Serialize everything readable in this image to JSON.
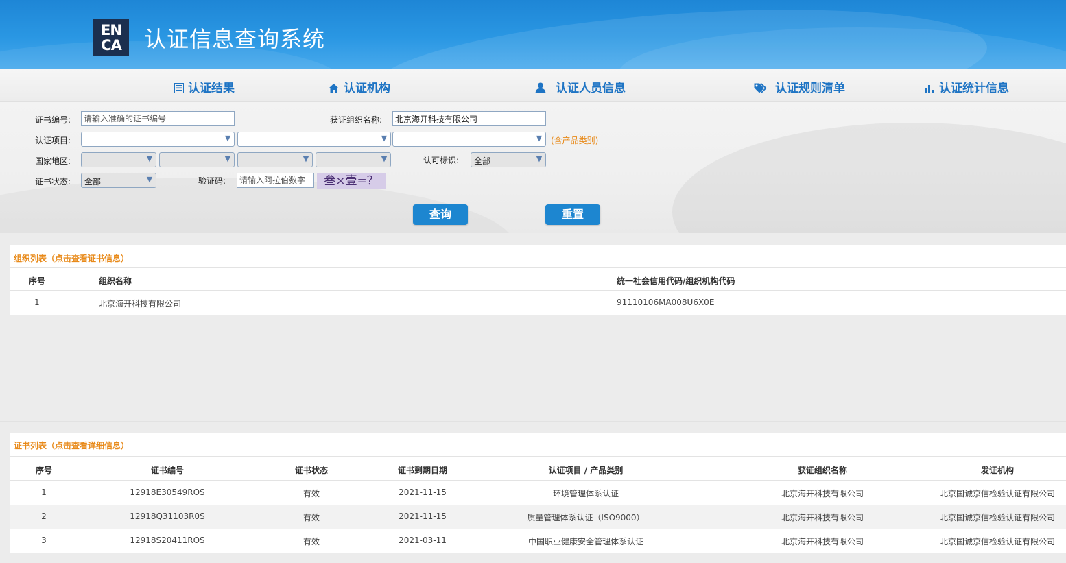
{
  "header": {
    "logo_text_top": "EN",
    "logo_text_bottom": "CA",
    "title": "认证信息查询系统"
  },
  "nav": [
    {
      "icon": "list-icon",
      "label": "认证结果"
    },
    {
      "icon": "home-icon",
      "label": "认证机构"
    },
    {
      "icon": "user-icon",
      "label": "认证人员信息"
    },
    {
      "icon": "tags-icon",
      "label": "认证规则清单"
    },
    {
      "icon": "bar-chart-icon",
      "label": "认证统计信息"
    }
  ],
  "search": {
    "cert_no_label": "证书编号:",
    "cert_no_placeholder": "请输入准确的证书编号",
    "org_name_label": "获证组织名称:",
    "org_name_value": "北京海开科技有限公司",
    "project_label": "认证项目:",
    "project_hint": "(含产品类别)",
    "region_label": "国家地区:",
    "accredit_label": "认可标识:",
    "accredit_value": "全部",
    "status_label": "证书状态:",
    "status_value": "全部",
    "captcha_label": "验证码:",
    "captcha_placeholder": "请输入阿拉伯数字",
    "captcha_text": "叁×壹=？",
    "query_button": "查询",
    "reset_button": "重置"
  },
  "org_list": {
    "title": "组织列表（点击查看证书信息）",
    "columns": [
      "序号",
      "组织名称",
      "统一社会信用代码/组织机构代码"
    ],
    "rows": [
      {
        "no": "1",
        "name": "北京海开科技有限公司",
        "code": "91110106MA008U6X0E"
      }
    ]
  },
  "cert_list": {
    "title": "证书列表（点击查看详细信息）",
    "columns": [
      "序号",
      "证书编号",
      "证书状态",
      "证书到期日期",
      "认证项目 / 产品类别",
      "获证组织名称",
      "发证机构"
    ],
    "rows": [
      {
        "no": "1",
        "cert_no": "12918E30549ROS",
        "status": "有效",
        "expiry": "2021-11-15",
        "project": "环境管理体系认证",
        "org": "北京海开科技有限公司",
        "issuer": "北京国诚京信检验认证有限公司"
      },
      {
        "no": "2",
        "cert_no": "12918Q31103R0S",
        "status": "有效",
        "expiry": "2021-11-15",
        "project": "质量管理体系认证（ISO9000）",
        "org": "北京海开科技有限公司",
        "issuer": "北京国诚京信检验认证有限公司"
      },
      {
        "no": "3",
        "cert_no": "12918S20411ROS",
        "status": "有效",
        "expiry": "2021-03-11",
        "project": "中国职业健康安全管理体系认证",
        "org": "北京海开科技有限公司",
        "issuer": "北京国诚京信检验认证有限公司"
      }
    ]
  },
  "colors": {
    "accent_blue": "#1d86d0",
    "nav_blue": "#1e74c4",
    "orange": "#e88a1a",
    "row_alt": "#f2f2f2"
  }
}
